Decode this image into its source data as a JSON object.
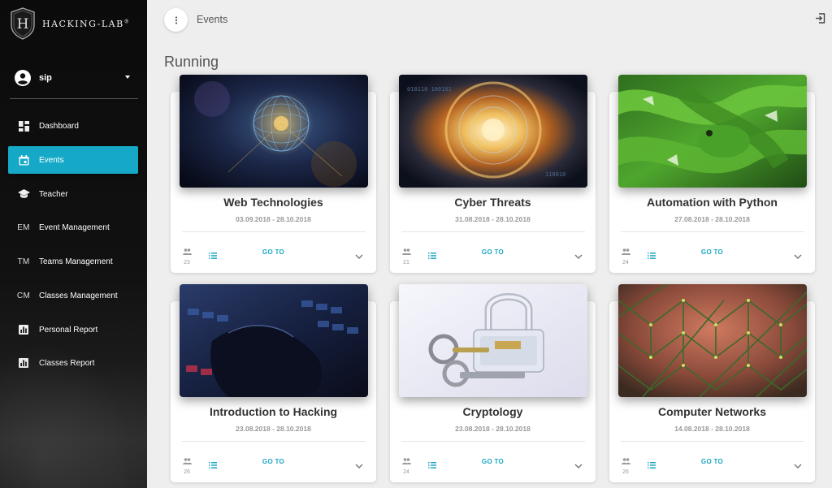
{
  "brand": {
    "name": "HACKING-LAB",
    "reg": "®"
  },
  "user": {
    "name": "sip"
  },
  "nav": [
    {
      "label": "Dashboard",
      "icon": "dashboard-icon"
    },
    {
      "label": "Events",
      "icon": "calendar-icon",
      "active": true
    },
    {
      "label": "Teacher",
      "icon": "school-icon"
    },
    {
      "label": "Event Management",
      "abbr": "EM"
    },
    {
      "label": "Teams Management",
      "abbr": "TM"
    },
    {
      "label": "Classes Management",
      "abbr": "CM"
    },
    {
      "label": "Personal Report",
      "icon": "bar-chart-icon"
    },
    {
      "label": "Classes Report",
      "icon": "bar-chart-icon"
    }
  ],
  "header": {
    "breadcrumb": "Events"
  },
  "section": {
    "title": "Running"
  },
  "goto_label": "GO TO",
  "events": [
    {
      "title": "Web Technologies",
      "dates": "03.09.2018 - 28.10.2018",
      "participants": "23",
      "image": "network-globe"
    },
    {
      "title": "Cyber Threats",
      "dates": "31.08.2018 - 28.10.2018",
      "participants": "21",
      "image": "burning-globe"
    },
    {
      "title": "Automation with Python",
      "dates": "27.08.2018 - 28.10.2018",
      "participants": "24",
      "image": "green-python-snake"
    },
    {
      "title": "Introduction to Hacking",
      "dates": "23.08.2018 - 28.10.2018",
      "participants": "26",
      "image": "keyboard-hand"
    },
    {
      "title": "Cryptology",
      "dates": "23.08.2018 - 28.10.2018",
      "participants": "24",
      "image": "padlock-keys"
    },
    {
      "title": "Computer Networks",
      "dates": "14.08.2018 - 28.10.2018",
      "participants": "26",
      "image": "wire-mesh"
    }
  ],
  "colors": {
    "accent": "#16a9c7",
    "sidebar": "#111111",
    "background": "#eeeeee"
  }
}
